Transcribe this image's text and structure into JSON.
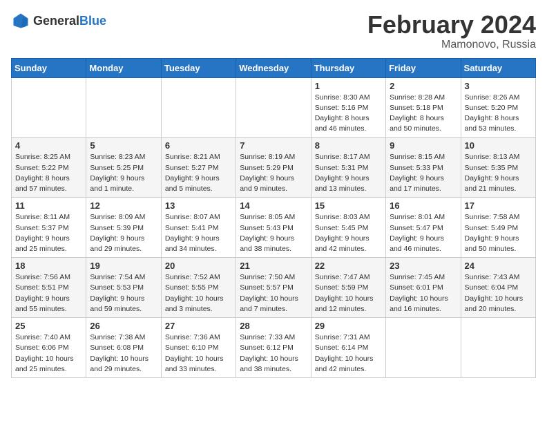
{
  "logo": {
    "text_general": "General",
    "text_blue": "Blue"
  },
  "header": {
    "month": "February 2024",
    "location": "Mamonovo, Russia"
  },
  "weekdays": [
    "Sunday",
    "Monday",
    "Tuesday",
    "Wednesday",
    "Thursday",
    "Friday",
    "Saturday"
  ],
  "weeks": [
    [
      {
        "day": "",
        "content": ""
      },
      {
        "day": "",
        "content": ""
      },
      {
        "day": "",
        "content": ""
      },
      {
        "day": "",
        "content": ""
      },
      {
        "day": "1",
        "content": "Sunrise: 8:30 AM\nSunset: 5:16 PM\nDaylight: 8 hours\nand 46 minutes."
      },
      {
        "day": "2",
        "content": "Sunrise: 8:28 AM\nSunset: 5:18 PM\nDaylight: 8 hours\nand 50 minutes."
      },
      {
        "day": "3",
        "content": "Sunrise: 8:26 AM\nSunset: 5:20 PM\nDaylight: 8 hours\nand 53 minutes."
      }
    ],
    [
      {
        "day": "4",
        "content": "Sunrise: 8:25 AM\nSunset: 5:22 PM\nDaylight: 8 hours\nand 57 minutes."
      },
      {
        "day": "5",
        "content": "Sunrise: 8:23 AM\nSunset: 5:25 PM\nDaylight: 9 hours\nand 1 minute."
      },
      {
        "day": "6",
        "content": "Sunrise: 8:21 AM\nSunset: 5:27 PM\nDaylight: 9 hours\nand 5 minutes."
      },
      {
        "day": "7",
        "content": "Sunrise: 8:19 AM\nSunset: 5:29 PM\nDaylight: 9 hours\nand 9 minutes."
      },
      {
        "day": "8",
        "content": "Sunrise: 8:17 AM\nSunset: 5:31 PM\nDaylight: 9 hours\nand 13 minutes."
      },
      {
        "day": "9",
        "content": "Sunrise: 8:15 AM\nSunset: 5:33 PM\nDaylight: 9 hours\nand 17 minutes."
      },
      {
        "day": "10",
        "content": "Sunrise: 8:13 AM\nSunset: 5:35 PM\nDaylight: 9 hours\nand 21 minutes."
      }
    ],
    [
      {
        "day": "11",
        "content": "Sunrise: 8:11 AM\nSunset: 5:37 PM\nDaylight: 9 hours\nand 25 minutes."
      },
      {
        "day": "12",
        "content": "Sunrise: 8:09 AM\nSunset: 5:39 PM\nDaylight: 9 hours\nand 29 minutes."
      },
      {
        "day": "13",
        "content": "Sunrise: 8:07 AM\nSunset: 5:41 PM\nDaylight: 9 hours\nand 34 minutes."
      },
      {
        "day": "14",
        "content": "Sunrise: 8:05 AM\nSunset: 5:43 PM\nDaylight: 9 hours\nand 38 minutes."
      },
      {
        "day": "15",
        "content": "Sunrise: 8:03 AM\nSunset: 5:45 PM\nDaylight: 9 hours\nand 42 minutes."
      },
      {
        "day": "16",
        "content": "Sunrise: 8:01 AM\nSunset: 5:47 PM\nDaylight: 9 hours\nand 46 minutes."
      },
      {
        "day": "17",
        "content": "Sunrise: 7:58 AM\nSunset: 5:49 PM\nDaylight: 9 hours\nand 50 minutes."
      }
    ],
    [
      {
        "day": "18",
        "content": "Sunrise: 7:56 AM\nSunset: 5:51 PM\nDaylight: 9 hours\nand 55 minutes."
      },
      {
        "day": "19",
        "content": "Sunrise: 7:54 AM\nSunset: 5:53 PM\nDaylight: 9 hours\nand 59 minutes."
      },
      {
        "day": "20",
        "content": "Sunrise: 7:52 AM\nSunset: 5:55 PM\nDaylight: 10 hours\nand 3 minutes."
      },
      {
        "day": "21",
        "content": "Sunrise: 7:50 AM\nSunset: 5:57 PM\nDaylight: 10 hours\nand 7 minutes."
      },
      {
        "day": "22",
        "content": "Sunrise: 7:47 AM\nSunset: 5:59 PM\nDaylight: 10 hours\nand 12 minutes."
      },
      {
        "day": "23",
        "content": "Sunrise: 7:45 AM\nSunset: 6:01 PM\nDaylight: 10 hours\nand 16 minutes."
      },
      {
        "day": "24",
        "content": "Sunrise: 7:43 AM\nSunset: 6:04 PM\nDaylight: 10 hours\nand 20 minutes."
      }
    ],
    [
      {
        "day": "25",
        "content": "Sunrise: 7:40 AM\nSunset: 6:06 PM\nDaylight: 10 hours\nand 25 minutes."
      },
      {
        "day": "26",
        "content": "Sunrise: 7:38 AM\nSunset: 6:08 PM\nDaylight: 10 hours\nand 29 minutes."
      },
      {
        "day": "27",
        "content": "Sunrise: 7:36 AM\nSunset: 6:10 PM\nDaylight: 10 hours\nand 33 minutes."
      },
      {
        "day": "28",
        "content": "Sunrise: 7:33 AM\nSunset: 6:12 PM\nDaylight: 10 hours\nand 38 minutes."
      },
      {
        "day": "29",
        "content": "Sunrise: 7:31 AM\nSunset: 6:14 PM\nDaylight: 10 hours\nand 42 minutes."
      },
      {
        "day": "",
        "content": ""
      },
      {
        "day": "",
        "content": ""
      }
    ]
  ]
}
